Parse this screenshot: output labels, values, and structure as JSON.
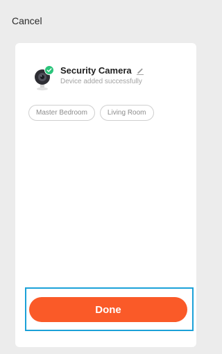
{
  "header": {
    "cancel_label": "Cancel"
  },
  "device": {
    "name": "Security Camera",
    "status": "Device added successfully",
    "icon": "camera-icon",
    "badge_icon": "check-icon",
    "edit_icon": "pencil-icon"
  },
  "rooms": [
    {
      "label": "Master Bedroom"
    },
    {
      "label": "Living Room"
    }
  ],
  "footer": {
    "done_label": "Done"
  },
  "colors": {
    "accent": "#fa5a28",
    "success": "#2bc47b",
    "highlight": "#1ba1d8"
  }
}
